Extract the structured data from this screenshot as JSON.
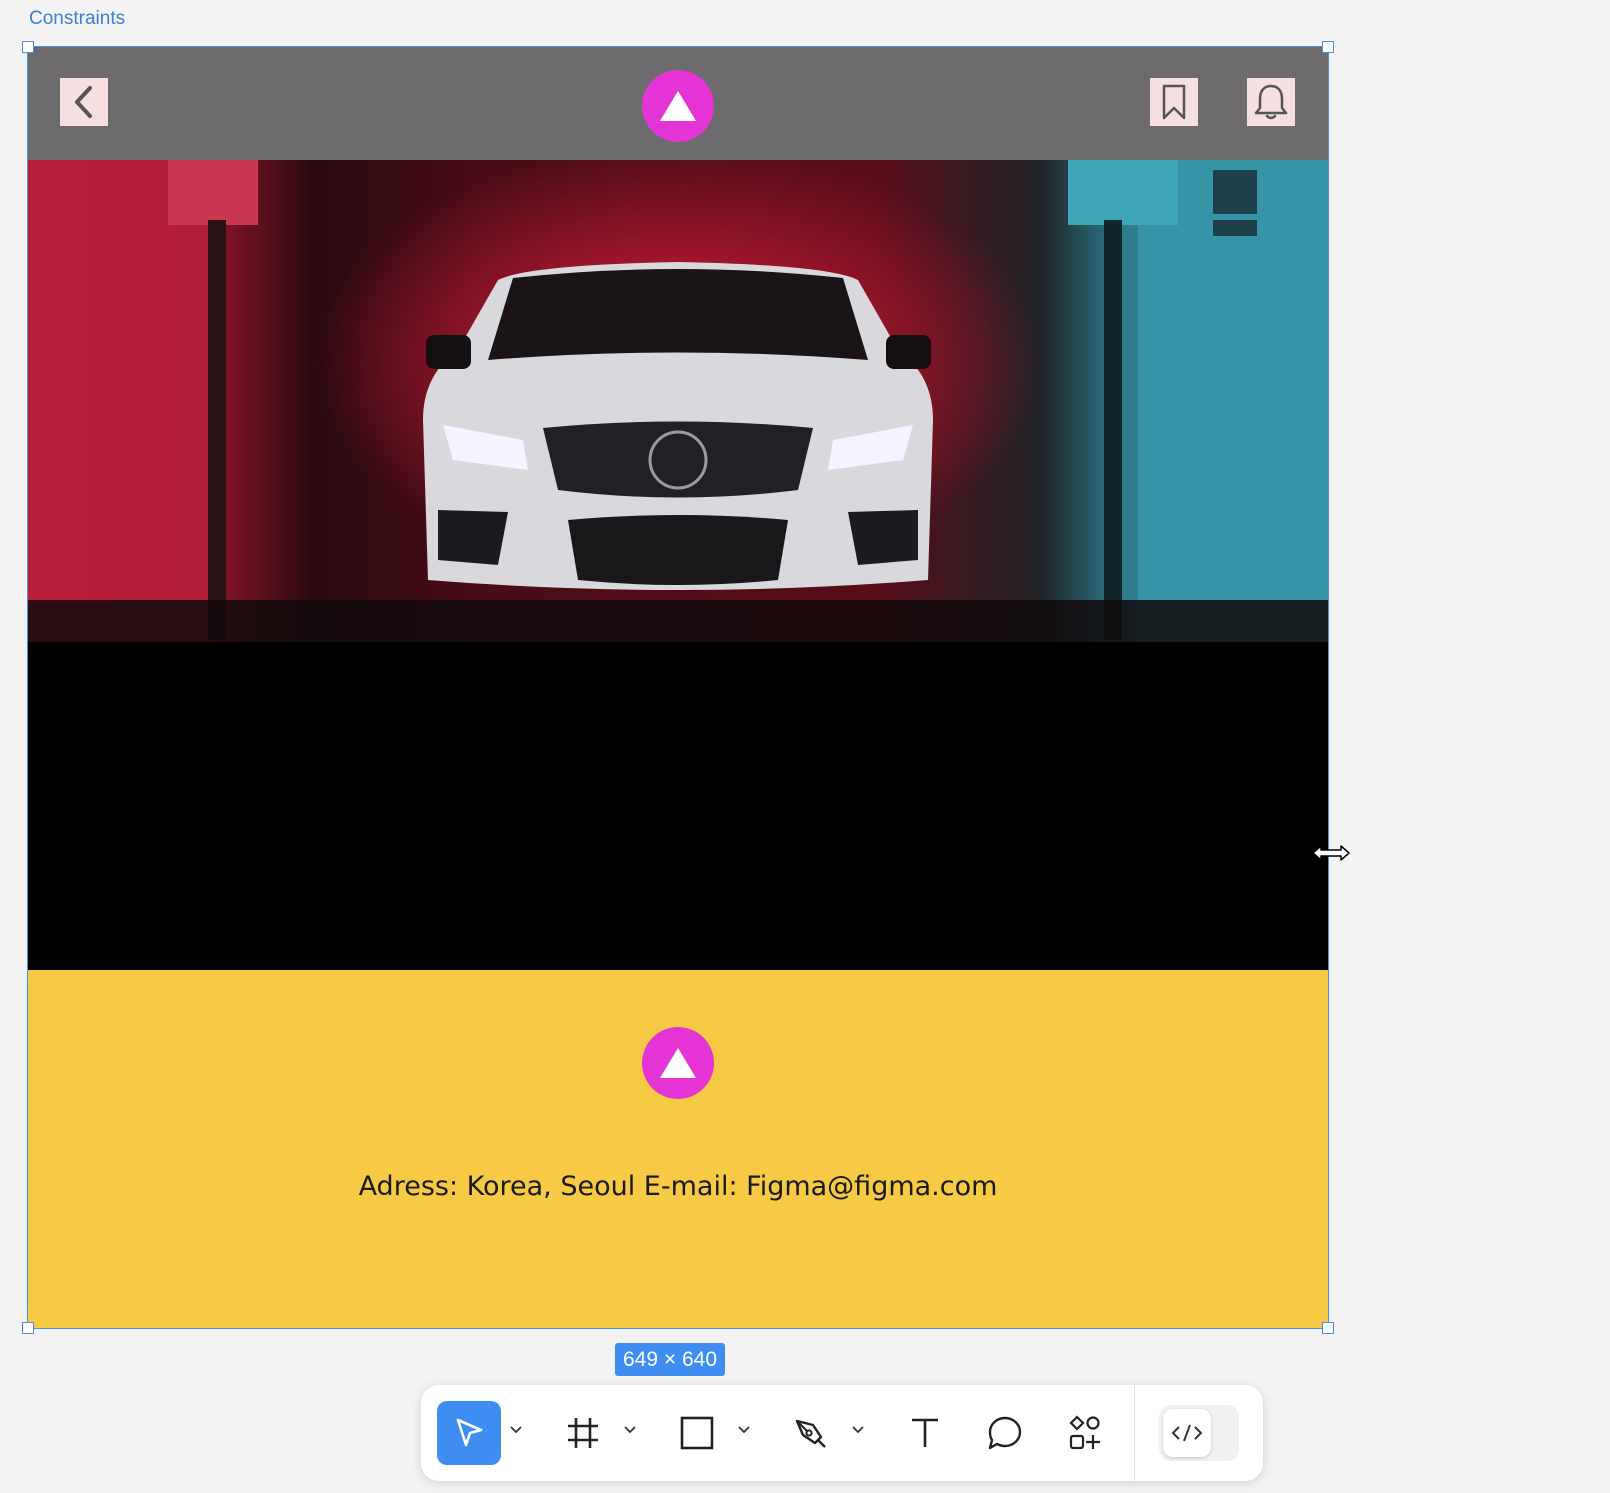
{
  "canvas": {
    "frame_label": "Constraints",
    "size_badge": "649 × 640"
  },
  "app_header": {
    "back_icon": "chevron-left-icon",
    "logo_icon": "triangle-logo-icon",
    "bookmark_icon": "bookmark-icon",
    "bell_icon": "bell-icon"
  },
  "hero": {
    "image_subject": "car-photo"
  },
  "footer": {
    "logo_icon": "triangle-logo-icon",
    "contact_text": "Adress:  Korea, Seoul E-mail: Figma@figma.com"
  },
  "toolbar": {
    "tools": [
      {
        "name": "move",
        "icon": "cursor-arrow-icon",
        "active": true
      },
      {
        "name": "frame",
        "icon": "hash-frame-icon"
      },
      {
        "name": "shape",
        "icon": "square-icon"
      },
      {
        "name": "pen",
        "icon": "pen-icon"
      },
      {
        "name": "text",
        "icon": "text-icon"
      },
      {
        "name": "comment",
        "icon": "comment-bubble-icon"
      },
      {
        "name": "resources",
        "icon": "shapes-plus-icon"
      },
      {
        "name": "dev-mode",
        "icon": "code-icon"
      }
    ]
  },
  "colors": {
    "selection": "#4a8fe0",
    "header_bg": "#6d6b6d",
    "icon_btn_bg": "#f6dfe0",
    "logo": "#e434d6",
    "footer_bg": "#f6ca44",
    "active_tool": "#3d8ef0"
  }
}
